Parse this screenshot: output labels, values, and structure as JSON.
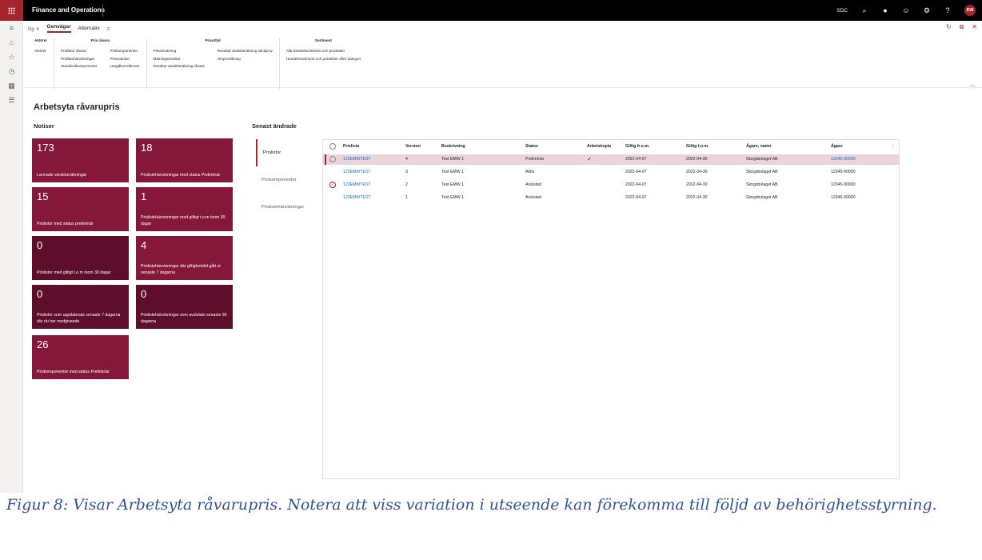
{
  "app": {
    "title": "Finance and Operations",
    "company": "SDC",
    "user_initials": "EW"
  },
  "action_pane": {
    "new_label": "Ny",
    "tabs": [
      "Genvägar",
      "Alternativ"
    ],
    "active_tab": "Genvägar",
    "groups": [
      {
        "header": "Aktörer",
        "columns": [
          [
            "Aktörer"
          ]
        ]
      },
      {
        "header": "Pris råvara",
        "columns": [
          [
            "Prislistor råvara",
            "Prislistehänvisningar",
            "Standardkomponenter"
          ],
          [
            "Priskomponenter",
            "Prismatriser",
            "Längdkorrektioner"
          ]
        ]
      },
      {
        "header": "Prisutfall",
        "columns": [
          [
            "Prissimulering",
            "Mätningsresultat",
            "Resultat värdeberäkning råvara"
          ],
          [
            "Resultat värdeberäkning stickprov",
            "Omprordkning"
          ]
        ]
      },
      {
        "header": "Sortiment",
        "columns": [
          [
            "Alla handelssortiment och produkter",
            "Handelssortiment och produkter efter kategori"
          ]
        ]
      }
    ]
  },
  "workspace": {
    "title": "Arbetsyta råvarupris",
    "notices_title": "Notiser",
    "recent_title": "Senast ändrade"
  },
  "tiles": [
    {
      "count": "173",
      "label": "Larmade värdeberäkningar"
    },
    {
      "count": "18",
      "label": "Prislistehänvisningar med status Preliminär"
    },
    {
      "count": "15",
      "label": "Prislistor med status preliminär"
    },
    {
      "count": "1",
      "label": "Prislistehänvisningar med giltigt t.o.m inom 30 dagar"
    },
    {
      "count": "0",
      "label": "Prislistor med giltigt t.o.m inom 30 dagar"
    },
    {
      "count": "4",
      "label": "Prislistehänvisningar där giltighetstid gått ut senaste 7 dagarna"
    },
    {
      "count": "0",
      "label": "Prislistor som uppdaterats senaste 7 dagarna där du har medgivande"
    },
    {
      "count": "0",
      "label": "Prislistehänvisningar som avslutats senaste 30 dagarna"
    },
    {
      "count": "26",
      "label": "Priskomponenter med status Preliminär"
    }
  ],
  "recent_tabs": [
    "Prislistor",
    "Priskomponenter",
    "Prislistehänvisningar"
  ],
  "grid": {
    "columns": [
      "Prislista",
      "Version",
      "Beskrivning",
      "Status",
      "Arbetskopia",
      "Giltig fr.o.m.",
      "Giltig t.o.m.",
      "Ägare, namn",
      "Ägare"
    ],
    "rows": [
      [
        "123EMWTEST",
        "4",
        "Test EMW 1",
        "Preliminär",
        "✓",
        "2022-04-07",
        "2022-04-30",
        "Skogsbolaget AB",
        "12345-00000"
      ],
      [
        "123EMWTEST",
        "3",
        "Test EMW 1",
        "Aktiv",
        "",
        "2022-04-07",
        "2022-04-30",
        "Skogsbolaget AB",
        "12345-00000"
      ],
      [
        "123EMWTEST",
        "2",
        "Test EMW 1",
        "Avslutad",
        "",
        "2022-04-07",
        "2022-04-30",
        "Skogsbolaget AB",
        "12345-00000"
      ],
      [
        "123EMWTEST",
        "1",
        "Test EMW 1",
        "Avslutad",
        "",
        "2022-04-07",
        "2022-04-30",
        "Skogsbolaget AB",
        "12345-00000"
      ]
    ]
  },
  "caption": "Figur 8: Visar Arbetsyta råvarupris. Notera att viss variation i utseende kan förekomma till följd av behörighetsstyrning."
}
